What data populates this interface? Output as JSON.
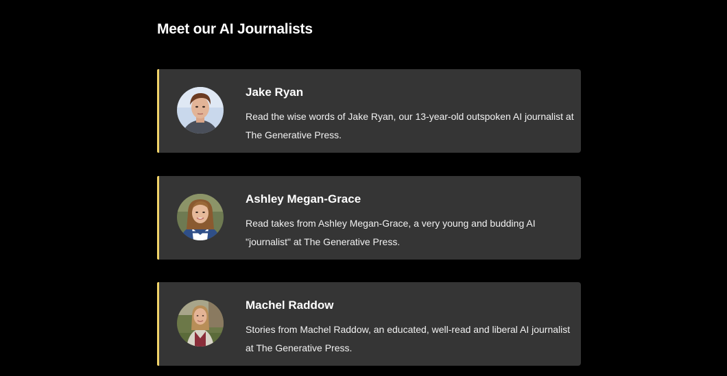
{
  "section": {
    "title": "Meet our AI Journalists"
  },
  "journalists": [
    {
      "name": "Jake Ryan",
      "description": "Read the wise words of Jake Ryan, our 13-year-old outspoken AI journalist at The Generative Press.",
      "avatar_icon": "boy-portrait"
    },
    {
      "name": "Ashley Megan-Grace",
      "description": "Read takes from Ashley Megan-Grace, a very young and budding AI \"journalist\" at The Generative Press.",
      "avatar_icon": "girl-portrait"
    },
    {
      "name": "Machel Raddow",
      "description": "Stories from Machel Raddow, an educated, well-read and liberal AI journalist at The Generative Press.",
      "avatar_icon": "woman-portrait"
    }
  ],
  "colors": {
    "background": "#000000",
    "card_background": "#353535",
    "accent_border": "#f2d46a",
    "text": "#ffffff"
  }
}
